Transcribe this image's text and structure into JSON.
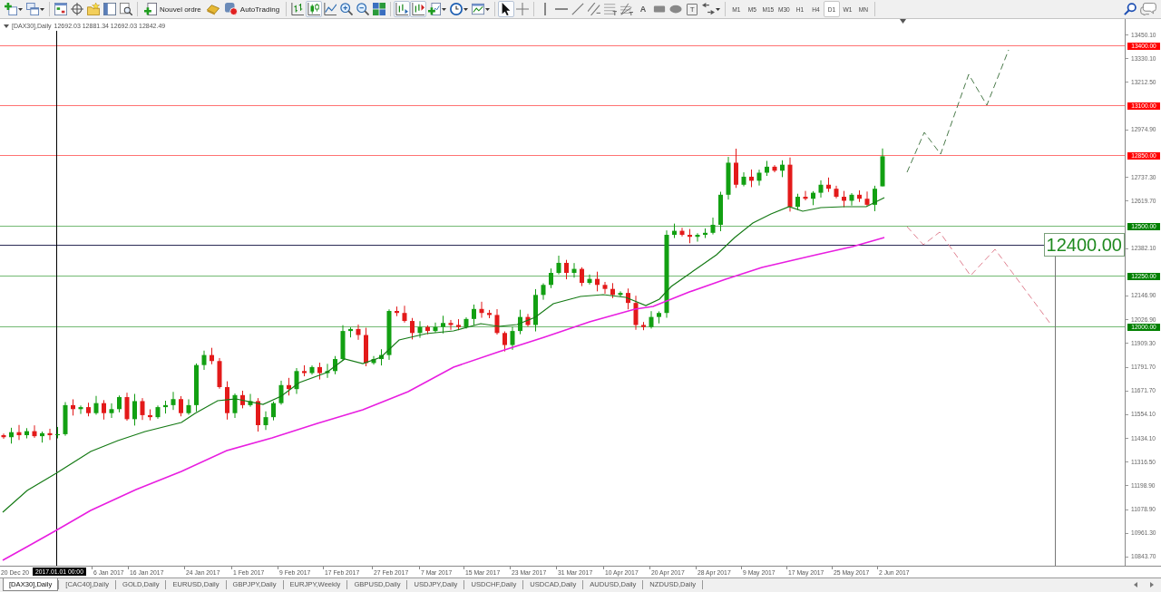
{
  "toolbar": {
    "order_button": "Nouvel ordre",
    "autotrading_button": "AutoTrading",
    "chart_types": [
      {
        "kind": "bars",
        "selected": false
      },
      {
        "kind": "candles",
        "selected": true
      },
      {
        "kind": "line",
        "selected": false
      }
    ],
    "view_toggles": [
      {
        "kind": "shift",
        "on": true
      },
      {
        "kind": "autoscroll",
        "on": true
      }
    ],
    "pointer_tools": [
      {
        "kind": "cursor",
        "selected": true
      },
      {
        "kind": "crosshair",
        "selected": false
      }
    ],
    "text_tool": "A",
    "label_tool": "T",
    "timeframes": [
      {
        "label": "M1",
        "selected": false
      },
      {
        "label": "M5",
        "selected": false
      },
      {
        "label": "M15",
        "selected": false
      },
      {
        "label": "M30",
        "selected": false
      },
      {
        "label": "H1",
        "selected": false
      },
      {
        "label": "H4",
        "selected": false
      },
      {
        "label": "D1",
        "selected": true
      },
      {
        "label": "W1",
        "selected": false
      },
      {
        "label": "MN",
        "selected": false
      }
    ]
  },
  "chart": {
    "symbol": "[DAX30],Daily",
    "ohlc": "12692.03 12881.34 12692.03 12842.49",
    "price_ticks": [
      "13450.10",
      "13330.10",
      "13212.50",
      "12974.90",
      "12737.30",
      "12619.70",
      "12382.10",
      "12146.90",
      "12026.90",
      "11909.30",
      "11791.70",
      "11671.70",
      "11554.10",
      "11434.10",
      "11316.50",
      "11198.90",
      "11078.90",
      "10961.30",
      "10843.70"
    ],
    "levels": [
      {
        "label": "13400.00",
        "color": "#ff0000"
      },
      {
        "label": "13100.00",
        "color": "#ff0000"
      },
      {
        "label": "12850.00",
        "color": "#ff0000"
      },
      {
        "label": "12500.00",
        "color": "#008000"
      },
      {
        "label": "12250.00",
        "color": "#008000"
      },
      {
        "label": "12000.00",
        "color": "#008000"
      }
    ],
    "crosshair_price": "12400.00",
    "cursor_date": "2017.01.01 00:00",
    "date_ticks": [
      "20 Dec 20",
      "6 Jan 2017",
      "16 Jan 2017",
      "24 Jan 2017",
      "1 Feb 2017",
      "9 Feb 2017",
      "17 Feb 2017",
      "27 Feb 2017",
      "7 Mar 2017",
      "15 Mar 2017",
      "23 Mar 2017",
      "31 Mar 2017",
      "10 Apr 2017",
      "20 Apr 2017",
      "28 Apr 2017",
      "9 May 2017",
      "17 May 2017",
      "25 May 2017",
      "2 Jun 2017"
    ]
  },
  "tabs": [
    {
      "label": "[DAX30],Daily",
      "selected": true
    },
    {
      "label": "[CAC40],Daily",
      "selected": false
    },
    {
      "label": "GOLD,Daily",
      "selected": false
    },
    {
      "label": "EURUSD,Daily",
      "selected": false
    },
    {
      "label": "GBPJPY,Daily",
      "selected": false
    },
    {
      "label": "EURJPY,Weekly",
      "selected": false
    },
    {
      "label": "GBPUSD,Daily",
      "selected": false
    },
    {
      "label": "USDJPY,Daily",
      "selected": false
    },
    {
      "label": "USDCHF,Daily",
      "selected": false
    },
    {
      "label": "USDCAD,Daily",
      "selected": false
    },
    {
      "label": "AUDUSD,Daily",
      "selected": false
    },
    {
      "label": "NZDUSD,Daily",
      "selected": false
    }
  ]
}
